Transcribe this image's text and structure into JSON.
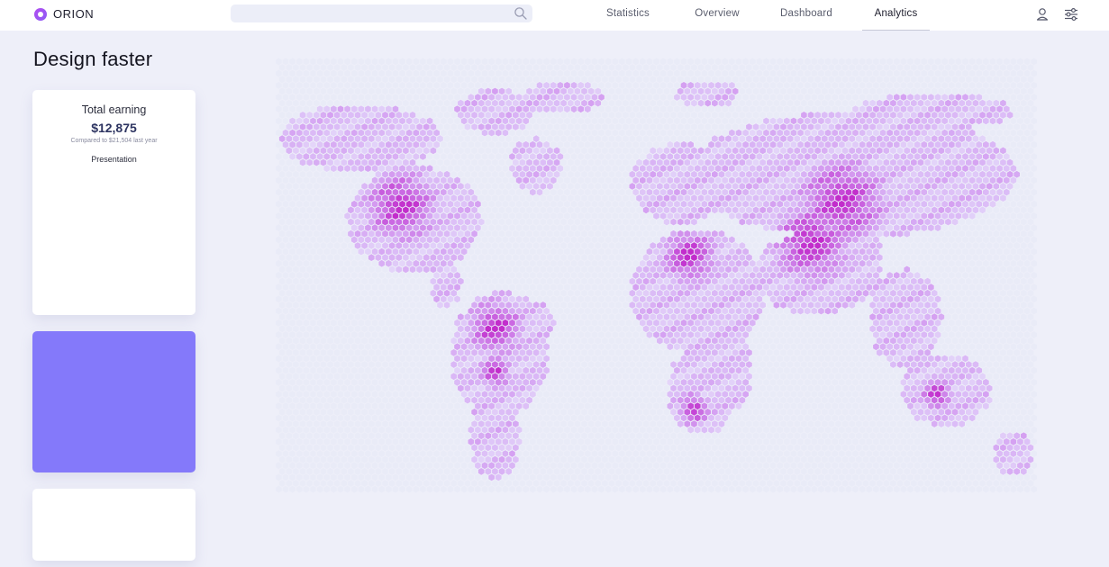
{
  "app": {
    "name": "ORION"
  },
  "search": {
    "placeholder": ""
  },
  "nav": {
    "tabs": [
      {
        "label": "Statistics",
        "active": false
      },
      {
        "label": "Overview",
        "active": false
      },
      {
        "label": "Dashboard",
        "active": false
      },
      {
        "label": "Analytics",
        "active": true
      }
    ]
  },
  "header_icons": [
    "user-icon",
    "sliders-icon"
  ],
  "page": {
    "title": "Design faster"
  },
  "earnings": {
    "title": "Total earning",
    "value": "$12,875",
    "compare": "Compared to $21,504 last year",
    "link": "Presentation"
  },
  "colors": {
    "background": "#eeeff9",
    "accent": "#8479fa",
    "map_high": "#c025c9",
    "map_low": "#f7e9ff"
  }
}
